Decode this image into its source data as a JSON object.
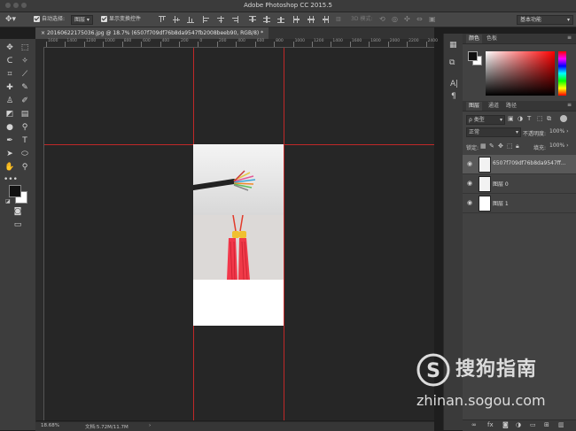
{
  "window": {
    "title": "Adobe Photoshop CC 2015.5"
  },
  "options_bar": {
    "auto_select_label": "自动选择:",
    "auto_select_value": "图层",
    "show_transform_label": "显示变换控件",
    "mode_3d_label": "3D 模式:",
    "workspace_value": "基本功能"
  },
  "document_tab": {
    "label": "20160622175036.jpg @ 18.7% (6507f709df76b8da9547fb2008beeb90, RGB/8) *"
  },
  "ruler": {
    "top_labels": [
      "1600",
      "1400",
      "1200",
      "1000",
      "800",
      "600",
      "400",
      "200",
      "0",
      "200",
      "400",
      "600",
      "800",
      "1000",
      "1200",
      "1400",
      "1600",
      "1800",
      "2000",
      "2200",
      "2400"
    ]
  },
  "status_bar": {
    "zoom": "18.68%",
    "doc_size": "文档:5.72M/11.7M"
  },
  "right_panel": {
    "color_tabs": [
      "颜色",
      "色板"
    ],
    "layer_tabs": [
      "图层",
      "通道",
      "路径"
    ],
    "kind_filter": "ρ 类型",
    "blend_mode": "正常",
    "opacity_label": "不透明度:",
    "opacity_value": "100%",
    "lock_label": "锁定:",
    "fill_label": "填充:",
    "fill_value": "100%",
    "layers": [
      {
        "name": "6507f709df76b8da9547ff..."
      },
      {
        "name": "图层 0"
      },
      {
        "name": "图层 1"
      }
    ],
    "bottom_icons": [
      "link-icon",
      "fx-icon",
      "mask-icon",
      "adjustment-icon",
      "folder-icon",
      "new-layer-icon",
      "trash-icon"
    ]
  },
  "watermark": {
    "name": "搜狗指南",
    "url": "zhinan.sogou.com"
  },
  "colors": {
    "guide": "#c02828",
    "canvas_bg": "#262626",
    "panel_bg": "#424242"
  }
}
